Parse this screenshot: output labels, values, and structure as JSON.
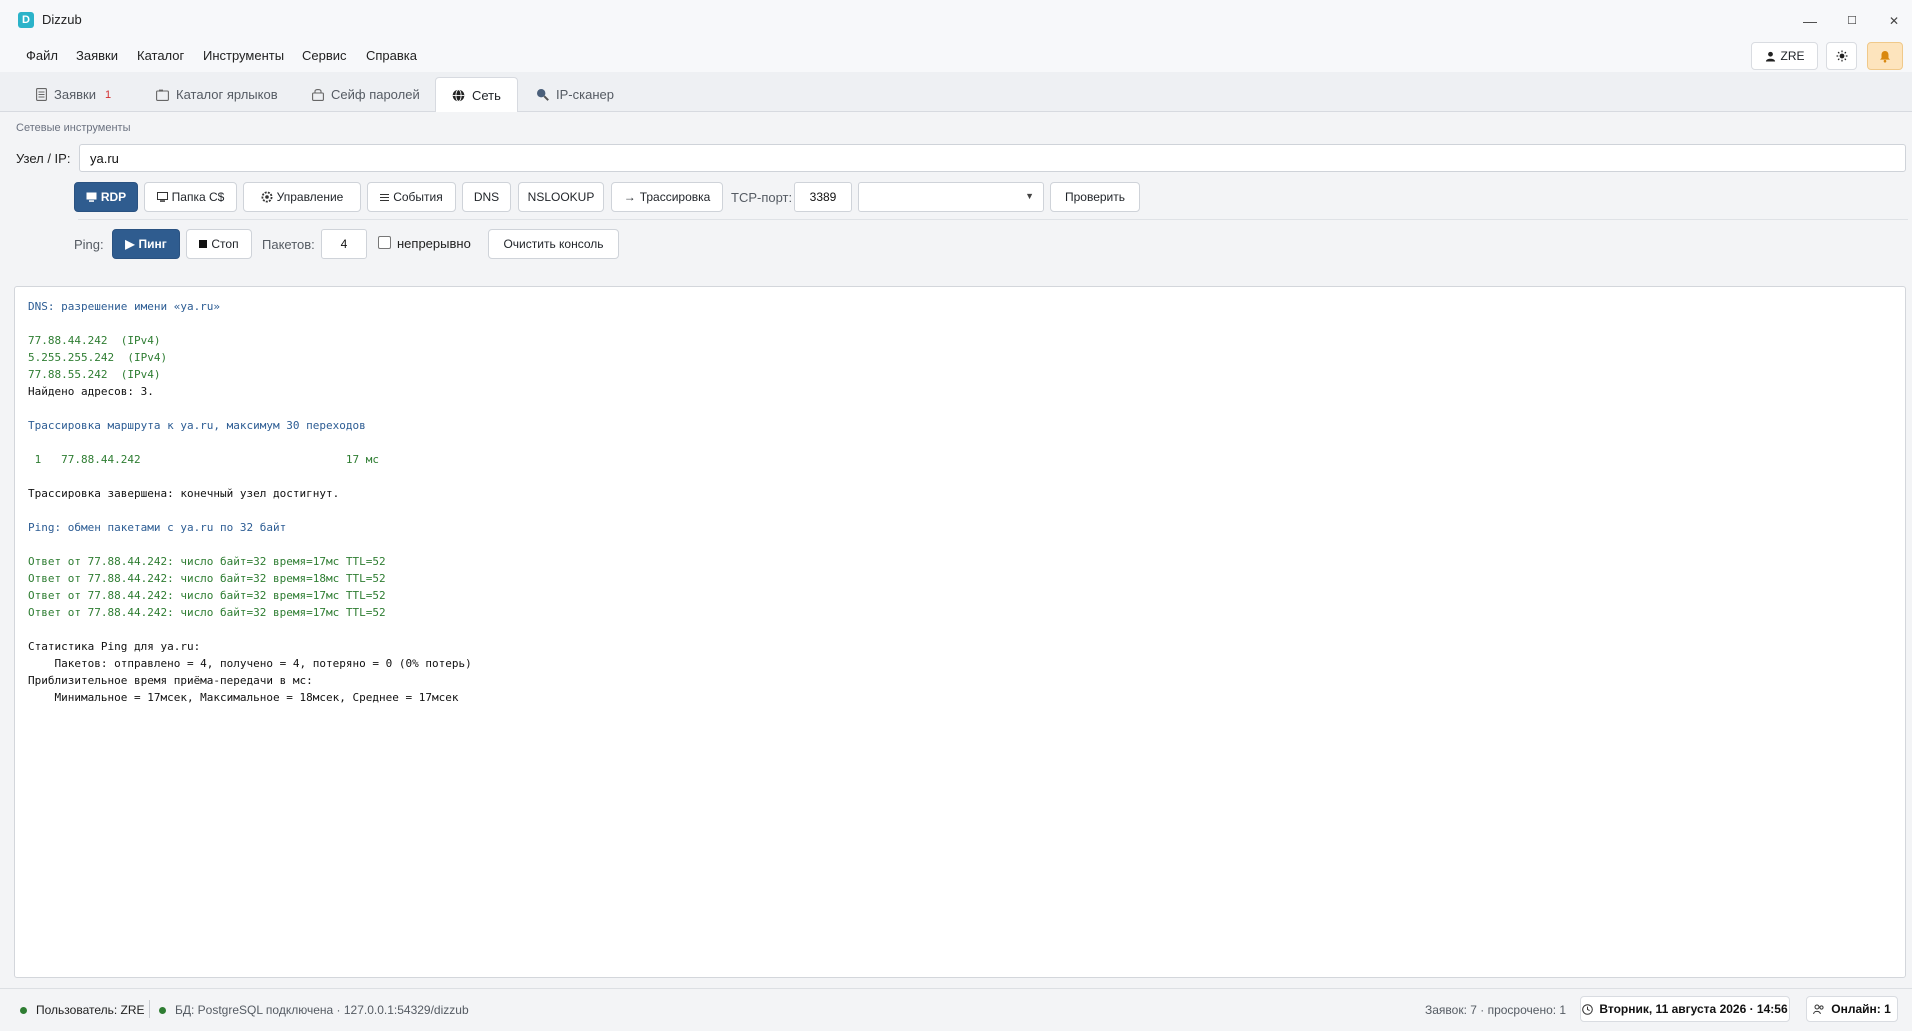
{
  "app": {
    "title": "Dizzub",
    "icon_letter": "D",
    "window_controls": {
      "minimize": "—",
      "maximize": "☐",
      "close": "✕"
    }
  },
  "menu": {
    "items": [
      "Файл",
      "Заявки",
      "Каталог",
      "Инструменты",
      "Сервис",
      "Справка"
    ]
  },
  "topbar": {
    "user_label": "ZRE",
    "theme_icon": "sun-icon",
    "bell_icon": "bell-icon"
  },
  "tabs": [
    {
      "label": "Заявки",
      "icon": "requests-icon",
      "badge": "1",
      "active": false
    },
    {
      "label": "Каталог ярлыков",
      "icon": "catalog-icon",
      "active": false
    },
    {
      "label": "Сейф паролей",
      "icon": "safe-icon",
      "active": false
    },
    {
      "label": "Сеть",
      "icon": "globe-icon",
      "active": true
    },
    {
      "label": "IP-сканер",
      "icon": "search-icon",
      "active": false
    }
  ],
  "network": {
    "section_title": "Сетевые инструменты",
    "host_label": "Узел / IP:",
    "host_value": "ya.ru",
    "buttons": {
      "rdp": "RDP",
      "share": "Папка C$",
      "manage": "Управление",
      "events": "События",
      "dns": "DNS",
      "nslookup": "NSLOOKUP",
      "trace": "Трассировка",
      "check": "Проверить"
    },
    "tcp_label": "TCP-порт:",
    "tcp_port": "3389",
    "service_select": "",
    "ping": {
      "label": "Ping:",
      "start": "Пинг",
      "stop": "Стоп",
      "packets_label": "Пакетов:",
      "packets_value": "4",
      "continuous_label": "непрерывно",
      "continuous_checked": false,
      "clear": "Очистить консоль"
    }
  },
  "console": {
    "lines": [
      {
        "text": "DNS: разрешение имени «ya.ru»",
        "color": "blue"
      },
      {
        "text": "",
        "color": "black"
      },
      {
        "text": "77.88.44.242  (IPv4)",
        "color": "green"
      },
      {
        "text": "5.255.255.242  (IPv4)",
        "color": "green"
      },
      {
        "text": "77.88.55.242  (IPv4)",
        "color": "green"
      },
      {
        "text": "Найдено адресов: 3.",
        "color": "black"
      },
      {
        "text": "",
        "color": "black"
      },
      {
        "text": "Трассировка маршрута к ya.ru, максимум 30 переходов",
        "color": "blue"
      },
      {
        "text": "",
        "color": "black"
      },
      {
        "text": " 1   77.88.44.242                               17 мс",
        "color": "green"
      },
      {
        "text": "",
        "color": "black"
      },
      {
        "text": "Трассировка завершена: конечный узел достигнут.",
        "color": "black"
      },
      {
        "text": "",
        "color": "black"
      },
      {
        "text": "Ping: обмен пакетами с ya.ru по 32 байт",
        "color": "blue"
      },
      {
        "text": "",
        "color": "black"
      },
      {
        "text": "Ответ от 77.88.44.242: число байт=32 время=17мс TTL=52",
        "color": "green"
      },
      {
        "text": "Ответ от 77.88.44.242: число байт=32 время=18мс TTL=52",
        "color": "green"
      },
      {
        "text": "Ответ от 77.88.44.242: число байт=32 время=17мс TTL=52",
        "color": "green"
      },
      {
        "text": "Ответ от 77.88.44.242: число байт=32 время=17мс TTL=52",
        "color": "green"
      },
      {
        "text": "",
        "color": "black"
      },
      {
        "text": "Статистика Ping для ya.ru:",
        "color": "black"
      },
      {
        "text": "    Пакетов: отправлено = 4, получено = 4, потеряно = 0 (0% потерь)",
        "color": "black"
      },
      {
        "text": "Приблизительное время приёма-передачи в мс:",
        "color": "black"
      },
      {
        "text": "    Минимальное = 17мсек, Максимальное = 18мсек, Среднее = 17мсек",
        "color": "black"
      }
    ]
  },
  "status": {
    "user": "Пользователь: ZRE",
    "db": "БД: PostgreSQL подключена · 127.0.0.1:54329/dizzub",
    "requests": "Заявок: 7 · просрочено: 1",
    "datetime": "Вторник, 11 августа 2026 · 14:56",
    "online": "Онлайн: 1"
  },
  "colors": {
    "accent": "#2f5c8f",
    "console_blue": "#2d5d94",
    "console_green": "#2e7d32",
    "status_ok": "#2e7d32",
    "badge": "#d32f2f",
    "bell_bg": "#fde4bd"
  }
}
